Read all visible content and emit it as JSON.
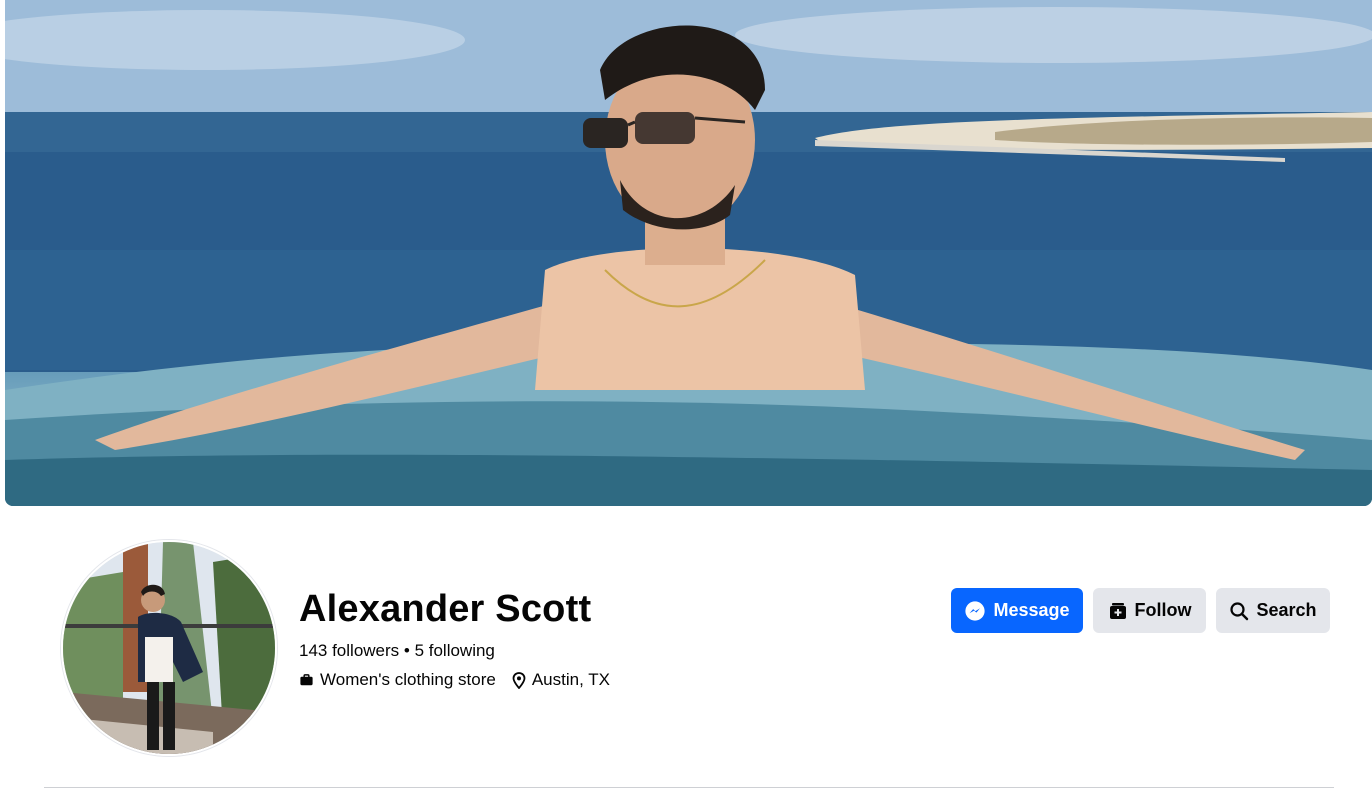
{
  "profile": {
    "name": "Alexander Scott",
    "stats": "143 followers • 5 following",
    "category": "Women's clothing store",
    "location": "Austin, TX"
  },
  "actions": {
    "message_label": "Message",
    "follow_label": "Follow",
    "search_label": "Search"
  },
  "colors": {
    "primary": "#0866ff",
    "secondary_button": "#e4e6eb",
    "text": "#050505"
  },
  "icons": {
    "message": "messenger-icon",
    "follow": "follow-icon",
    "search": "search-icon",
    "category": "briefcase-icon",
    "location": "location-pin-icon"
  }
}
